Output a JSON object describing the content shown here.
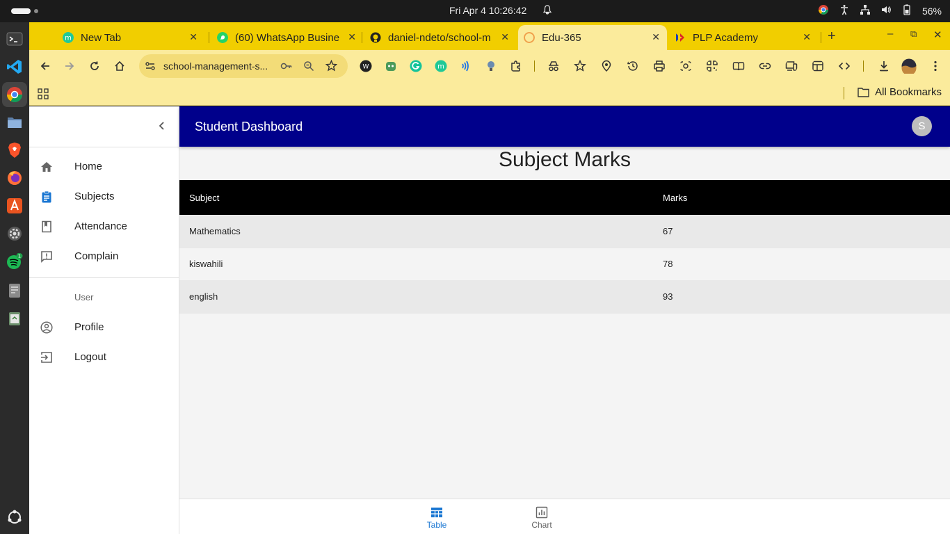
{
  "system": {
    "clock": "Fri Apr 4  10:26:42",
    "battery": "56%"
  },
  "browser": {
    "tabs": [
      {
        "label": "New Tab",
        "active": false
      },
      {
        "label": "(60) WhatsApp Busine",
        "active": false
      },
      {
        "label": "daniel-ndeto/school-m",
        "active": false
      },
      {
        "label": "Edu-365",
        "active": true
      },
      {
        "label": "PLP Academy",
        "active": false
      }
    ],
    "url": "school-management-s...",
    "bookmarks_label": "All Bookmarks"
  },
  "sidebar": {
    "items": [
      {
        "label": "Home",
        "icon": "home-icon"
      },
      {
        "label": "Subjects",
        "icon": "assignment-icon"
      },
      {
        "label": "Attendance",
        "icon": "bookmark-icon"
      },
      {
        "label": "Complain",
        "icon": "feedback-icon"
      }
    ],
    "user_header": "User",
    "user_items": [
      {
        "label": "Profile",
        "icon": "account-circle-icon"
      },
      {
        "label": "Logout",
        "icon": "exit-icon"
      }
    ]
  },
  "appbar": {
    "title": "Student Dashboard",
    "avatar_initial": "S"
  },
  "main": {
    "heading": "Subject Marks",
    "table": {
      "headers": [
        "Subject",
        "Marks"
      ],
      "rows": [
        {
          "subject": "Mathematics",
          "marks": "67"
        },
        {
          "subject": "kiswahili",
          "marks": "78"
        },
        {
          "subject": "english",
          "marks": "93"
        }
      ]
    }
  },
  "bottom_nav": {
    "items": [
      {
        "label": "Table",
        "active": true
      },
      {
        "label": "Chart",
        "active": false
      }
    ]
  },
  "colors": {
    "appbar": "#00008b",
    "browser_chrome": "#f1ce00",
    "active_nav": "#1976d2"
  }
}
